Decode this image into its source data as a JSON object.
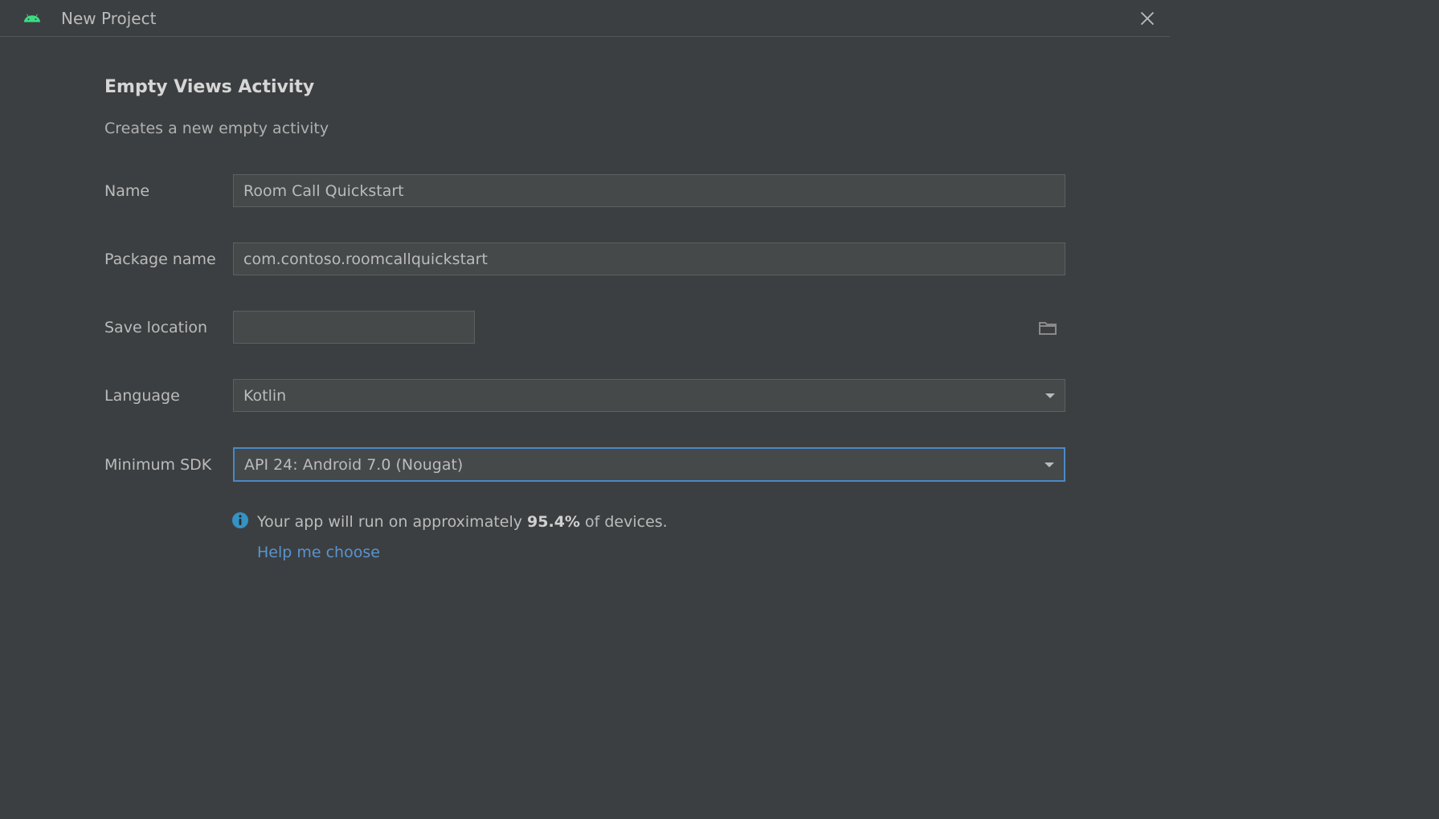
{
  "titlebar": {
    "title": "New Project"
  },
  "page": {
    "heading": "Empty Views Activity",
    "subheading": "Creates a new empty activity"
  },
  "form": {
    "name": {
      "label": "Name",
      "value": "Room Call Quickstart"
    },
    "packageName": {
      "label": "Package name",
      "value": "com.contoso.roomcallquickstart"
    },
    "saveLocation": {
      "label": "Save location",
      "value": ""
    },
    "language": {
      "label": "Language",
      "value": "Kotlin"
    },
    "minimumSdk": {
      "label": "Minimum SDK",
      "value": "API 24: Android 7.0 (Nougat)"
    }
  },
  "info": {
    "prefix": "Your app will run on approximately ",
    "percentage": "95.4%",
    "suffix": " of devices.",
    "helpLink": "Help me choose"
  }
}
